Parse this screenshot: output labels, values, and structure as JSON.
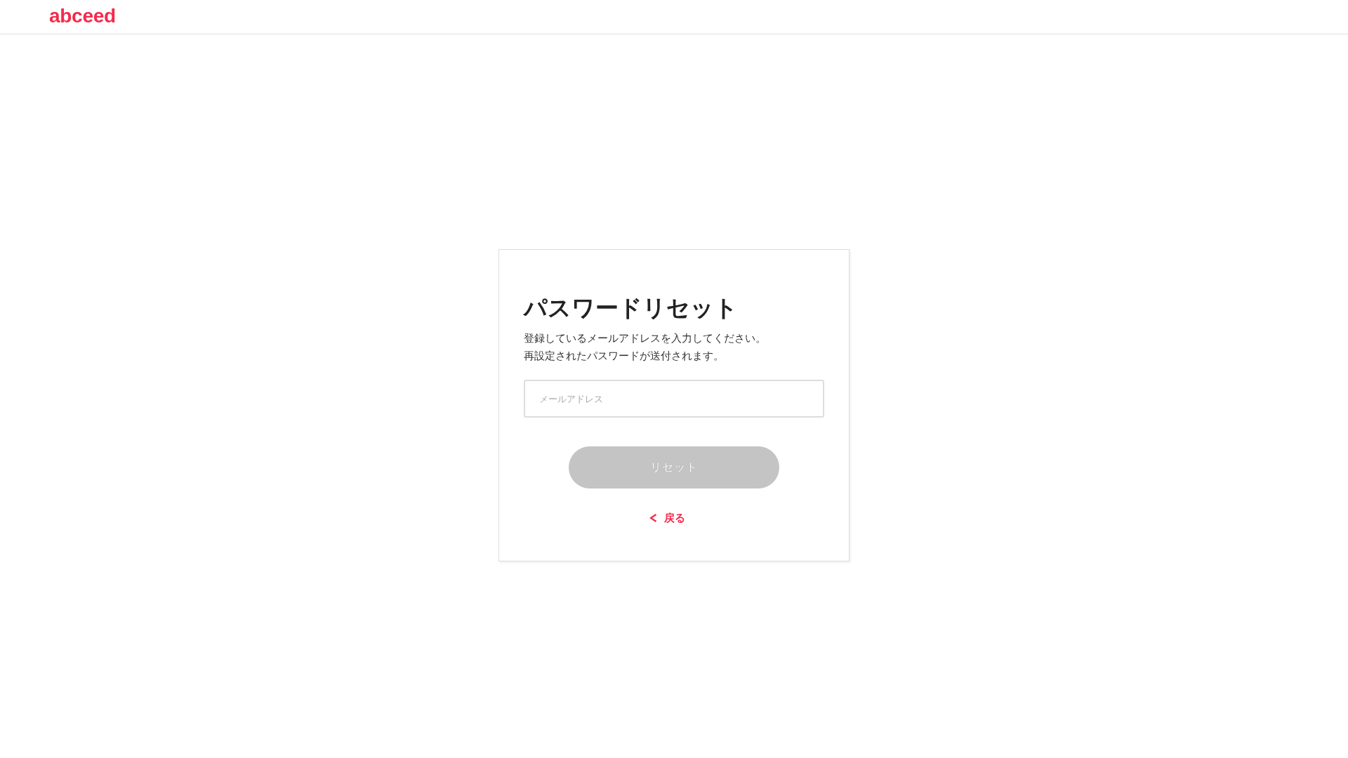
{
  "header": {
    "logo": "abceed"
  },
  "card": {
    "title": "パスワードリセット",
    "description": [
      "登録しているメールアドレスを入力してください。",
      "再設定されたパスワードが送付されます。"
    ],
    "email_field": {
      "placeholder": "メールアドレス"
    },
    "reset_button": {
      "label": "リセット",
      "disabled": true
    },
    "back_link": {
      "label": "戻る"
    }
  }
}
